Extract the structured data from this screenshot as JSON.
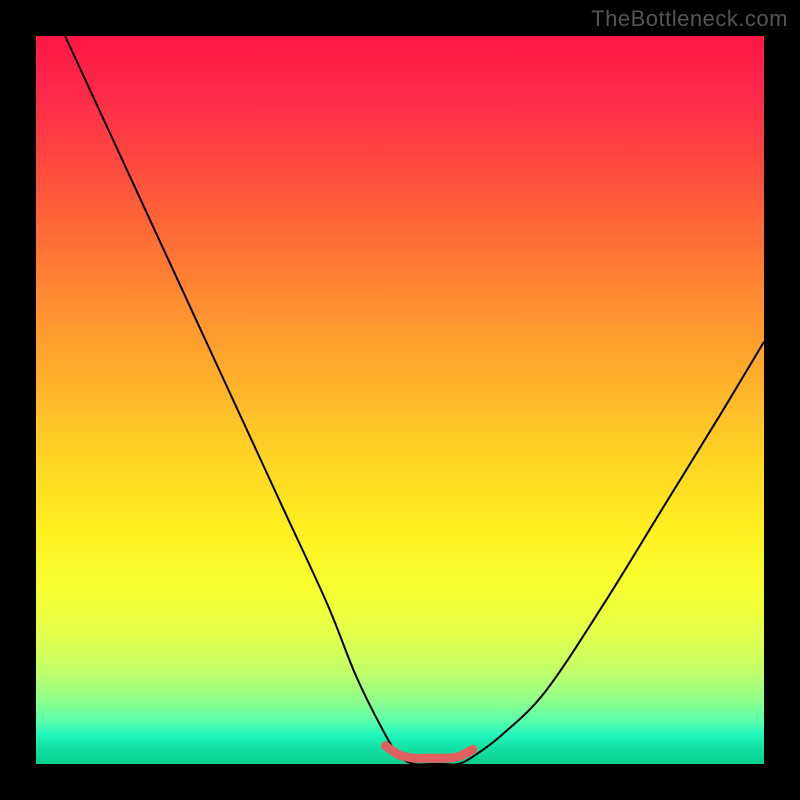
{
  "watermark": {
    "text": "TheBottleneck.com"
  },
  "chart_data": {
    "type": "line",
    "title": "",
    "xlabel": "",
    "ylabel": "",
    "xlim": [
      0,
      100
    ],
    "ylim": [
      0,
      100
    ],
    "grid": false,
    "legend": false,
    "series": [
      {
        "name": "bottleneck-curve",
        "stroke": "#000000",
        "stroke_width": 2,
        "x": [
          4,
          10,
          16,
          22,
          28,
          34,
          40,
          44,
          48,
          50,
          52,
          54,
          56,
          58,
          60,
          64,
          70,
          78,
          86,
          94,
          100
        ],
        "y": [
          100,
          87,
          74,
          61,
          48,
          35,
          22,
          12,
          4,
          1,
          0,
          0,
          0,
          0,
          1,
          4,
          10,
          22,
          35,
          48,
          58
        ]
      },
      {
        "name": "highlight-segment",
        "stroke": "#e06060",
        "stroke_width": 9,
        "x": [
          48,
          50,
          52,
          54,
          56,
          58,
          60
        ],
        "y": [
          2.5,
          1.2,
          0.8,
          0.8,
          0.8,
          1.0,
          2.0
        ]
      }
    ],
    "background_gradient": {
      "orientation": "vertical",
      "stops": [
        {
          "pos": 0.0,
          "color": "#ff1744"
        },
        {
          "pos": 0.18,
          "color": "#ff4a3e"
        },
        {
          "pos": 0.38,
          "color": "#ff9230"
        },
        {
          "pos": 0.58,
          "color": "#ffd424"
        },
        {
          "pos": 0.76,
          "color": "#f6ff30"
        },
        {
          "pos": 0.9,
          "color": "#92ff88"
        },
        {
          "pos": 1.0,
          "color": "#0ccf8f"
        }
      ]
    }
  }
}
